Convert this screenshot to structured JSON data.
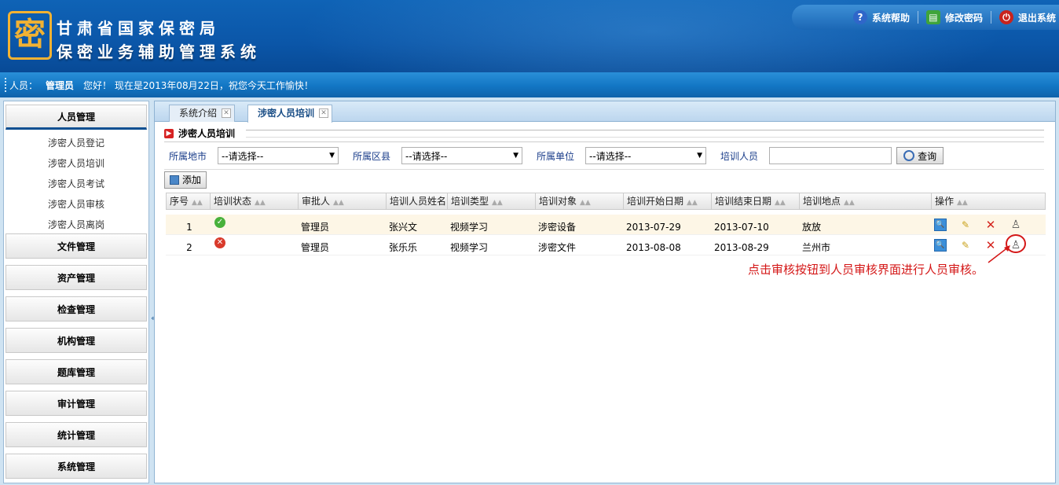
{
  "header": {
    "logo_char": "密",
    "title_line1": "甘肃省国家保密局",
    "title_line2": "保密业务辅助管理系统",
    "nav": [
      {
        "label": "系统帮助",
        "icon": "help-icon",
        "color": "#2f66c9"
      },
      {
        "label": "修改密码",
        "icon": "printer-icon",
        "color": "#3fa43a"
      },
      {
        "label": "退出系统",
        "icon": "power-icon",
        "color": "#c8231d"
      }
    ]
  },
  "infobar": {
    "prefix": "人员：",
    "user": "管理员",
    "greeting": "您好！ 现在是2013年08月22日，祝您今天工作愉快！"
  },
  "sidebar": {
    "groups": [
      {
        "label": "人员管理",
        "items": [
          "涉密人员登记",
          "涉密人员培训",
          "涉密人员考试",
          "涉密人员审核",
          "涉密人员离岗"
        ]
      },
      {
        "label": "文件管理"
      },
      {
        "label": "资产管理"
      },
      {
        "label": "检查管理"
      },
      {
        "label": "机构管理"
      },
      {
        "label": "题库管理"
      },
      {
        "label": "审计管理"
      },
      {
        "label": "统计管理"
      },
      {
        "label": "系统管理"
      }
    ],
    "collapse": "«"
  },
  "tabs": [
    {
      "label": "系统介绍",
      "active": false
    },
    {
      "label": "涉密人员培训",
      "active": true
    }
  ],
  "panel": {
    "title": "涉密人员培训",
    "filters": [
      {
        "label": "所属地市",
        "value": "--请选择--"
      },
      {
        "label": "所属区县",
        "value": "--请选择--"
      },
      {
        "label": "所属单位",
        "value": "--请选择--"
      }
    ],
    "trainee_label": "培训人员",
    "trainee_value": "",
    "query_label": "查询",
    "add_label": "添加"
  },
  "grid": {
    "columns": [
      "序号",
      "培训状态",
      "审批人",
      "培训人员姓名",
      "培训类型",
      "培训对象",
      "培训开始日期",
      "培训结束日期",
      "培训地点",
      "操作"
    ],
    "rows": [
      {
        "no": "1",
        "status": "ok",
        "approver": "管理员",
        "name": "张兴文",
        "type": "视频学习",
        "target": "涉密设备",
        "start": "2013-07-29",
        "end": "2013-07-10",
        "place": "放放"
      },
      {
        "no": "2",
        "status": "no",
        "approver": "管理员",
        "name": "张乐乐",
        "type": "视频学习",
        "target": "涉密文件",
        "start": "2013-08-08",
        "end": "2013-08-29",
        "place": "兰州市"
      }
    ]
  },
  "annotation": {
    "text": "点击审核按钮到人员审核界面进行人员审核。",
    "color": "#d41717"
  }
}
